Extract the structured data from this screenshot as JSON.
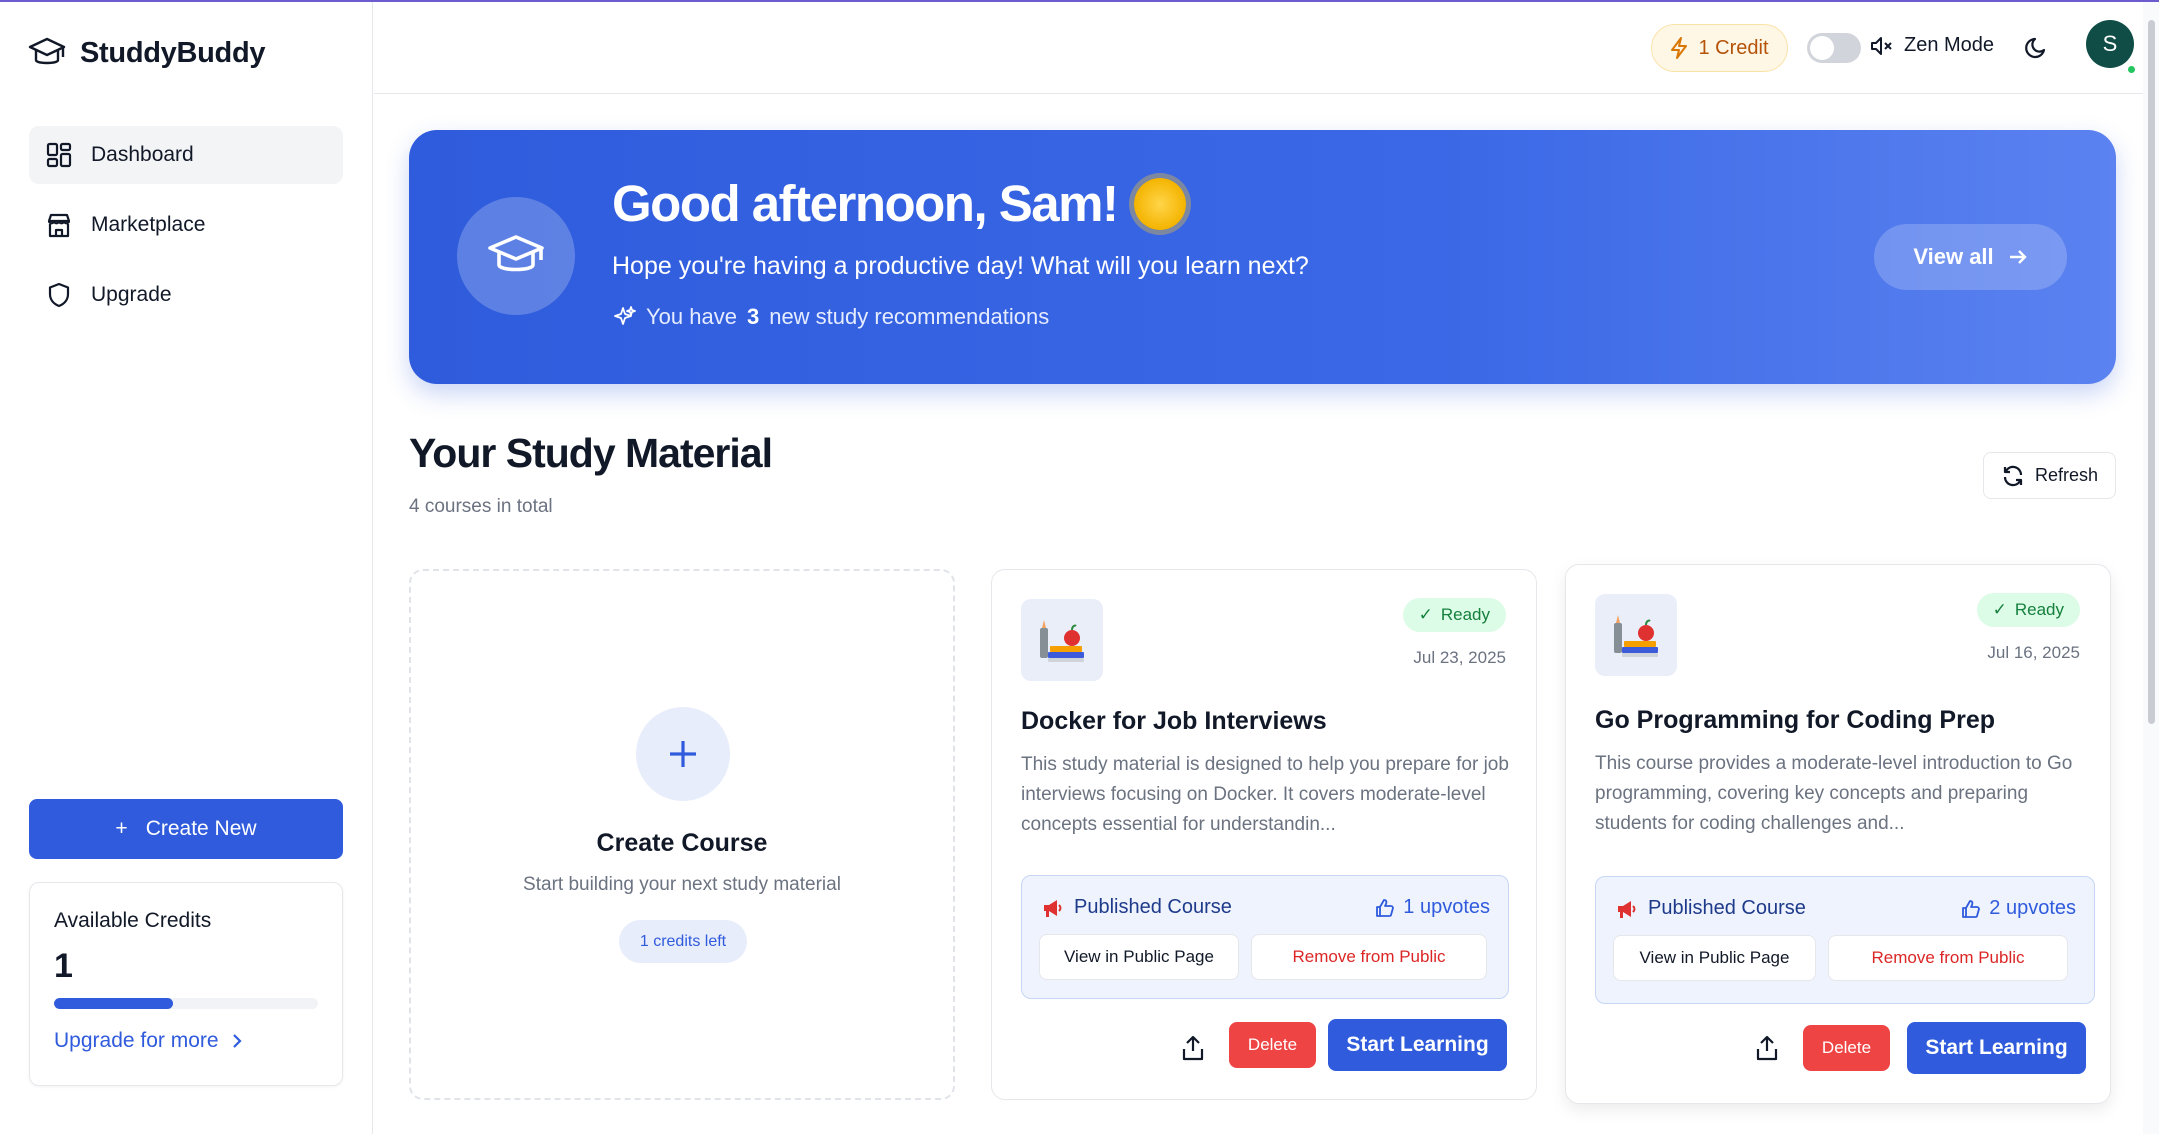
{
  "app": {
    "name": "StuddyBuddy"
  },
  "sidebar": {
    "items": [
      {
        "label": "Dashboard",
        "icon": "dashboard-icon",
        "active": true
      },
      {
        "label": "Marketplace",
        "icon": "store-icon"
      },
      {
        "label": "Upgrade",
        "icon": "shield-icon"
      }
    ],
    "create_label": "Create New",
    "credits": {
      "title": "Available Credits",
      "value": "1",
      "progress": 0.45,
      "upgrade_label": "Upgrade for more"
    }
  },
  "header": {
    "credit_label": "1 Credit",
    "zen_label": "Zen Mode",
    "avatar_initial": "S"
  },
  "hero": {
    "greeting": "Good afternoon, Sam!",
    "subtitle": "Hope you're having a productive day! What will you learn next?",
    "rec_prefix": "You have",
    "rec_count": "3",
    "rec_suffix": "new study recommendations",
    "view_all": "View all"
  },
  "section": {
    "title": "Your Study Material",
    "count": "4 courses in total",
    "refresh": "Refresh"
  },
  "create_card": {
    "title": "Create Course",
    "subtitle": "Start building your next study material",
    "credits_left": "1 credits left"
  },
  "courses": [
    {
      "status": "Ready",
      "date": "Jul 23, 2025",
      "title": "Docker for Job Interviews",
      "description": "This study material is designed to help you prepare for job interviews focusing on Docker. It covers moderate-level concepts essential for understandin...",
      "published_label": "Published Course",
      "upvotes": "1 upvotes",
      "view_public": "View in Public Page",
      "remove_public": "Remove from Public",
      "delete": "Delete",
      "start": "Start Learning"
    },
    {
      "status": "Ready",
      "date": "Jul 16, 2025",
      "title": "Go Programming for Coding Prep",
      "description": "This course provides a moderate-level introduction to Go programming, covering key concepts and preparing students for coding challenges and...",
      "published_label": "Published Course",
      "upvotes": "2 upvotes",
      "view_public": "View in Public Page",
      "remove_public": "Remove from Public",
      "delete": "Delete",
      "start": "Start Learning"
    }
  ],
  "colors": {
    "primary": "#2f5bdc",
    "danger": "#ef4444",
    "success_bg": "#dcfce7",
    "credit_text": "#b45309"
  }
}
